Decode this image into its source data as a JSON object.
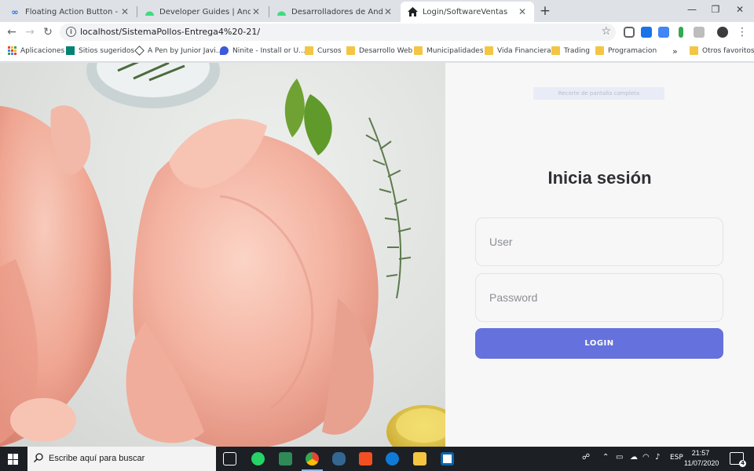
{
  "browser": {
    "tabs": [
      {
        "title": "Floating Action Button - Univers",
        "icon": "infinity-icon"
      },
      {
        "title": "Developer Guides | Android Dev",
        "icon": "android-icon"
      },
      {
        "title": "Desarrolladores de Android | An",
        "icon": "android-icon"
      },
      {
        "title": "Login/SoftwareVentas",
        "icon": "home-icon",
        "active": true
      }
    ],
    "url": "localhost/SistemaPollos-Entrega4%20-21/",
    "bookmarks": [
      {
        "label": "Aplicaciones",
        "icon": "apps-grid-icon"
      },
      {
        "label": "Sitios sugeridos",
        "icon": "bing-icon"
      },
      {
        "label": "A Pen by Junior Javi...",
        "icon": "codepen-icon"
      },
      {
        "label": "Ninite - Install or U...",
        "icon": "ninite-icon"
      },
      {
        "label": "Cursos",
        "icon": "folder-icon"
      },
      {
        "label": "Desarrollo Web",
        "icon": "folder-icon"
      },
      {
        "label": "Municipalidades",
        "icon": "folder-icon"
      },
      {
        "label": "Vida Financiera",
        "icon": "folder-icon"
      },
      {
        "label": "Trading",
        "icon": "folder-icon"
      },
      {
        "label": "Programacion",
        "icon": "folder-icon"
      }
    ],
    "overflow_label": "»",
    "other_favorites": "Otros favoritos"
  },
  "page": {
    "capture_label": "Recorte de pantalla completa",
    "title": "Inicia sesión",
    "user_placeholder": "User",
    "password_placeholder": "Password",
    "login_label": "LOGIN",
    "colors": {
      "accent": "#6571dc",
      "panel_bg": "#f7f7f8"
    }
  },
  "taskbar": {
    "search_placeholder": "Escribe aquí para buscar",
    "language": "ESP",
    "time": "21:57",
    "date": "11/07/2020",
    "notification_count": "4"
  }
}
